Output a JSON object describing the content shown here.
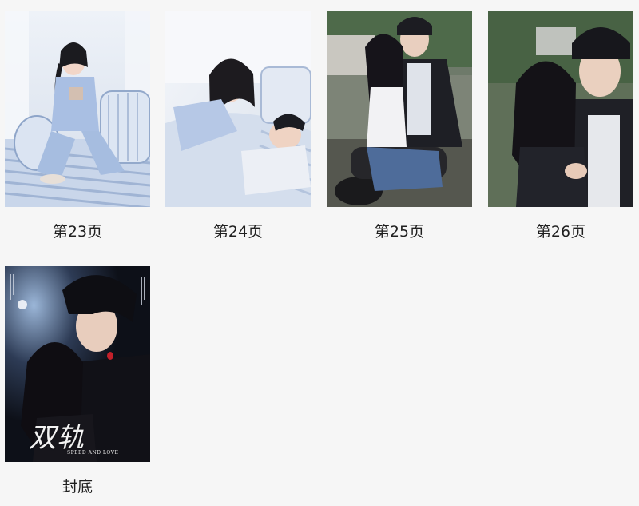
{
  "pages": [
    {
      "label": "第23页"
    },
    {
      "label": "第24页"
    },
    {
      "label": "第25页"
    },
    {
      "label": "第26页"
    },
    {
      "label": "封底",
      "cover_title": "双轨",
      "cover_subtitle": "SPEED AND LOVE"
    }
  ]
}
